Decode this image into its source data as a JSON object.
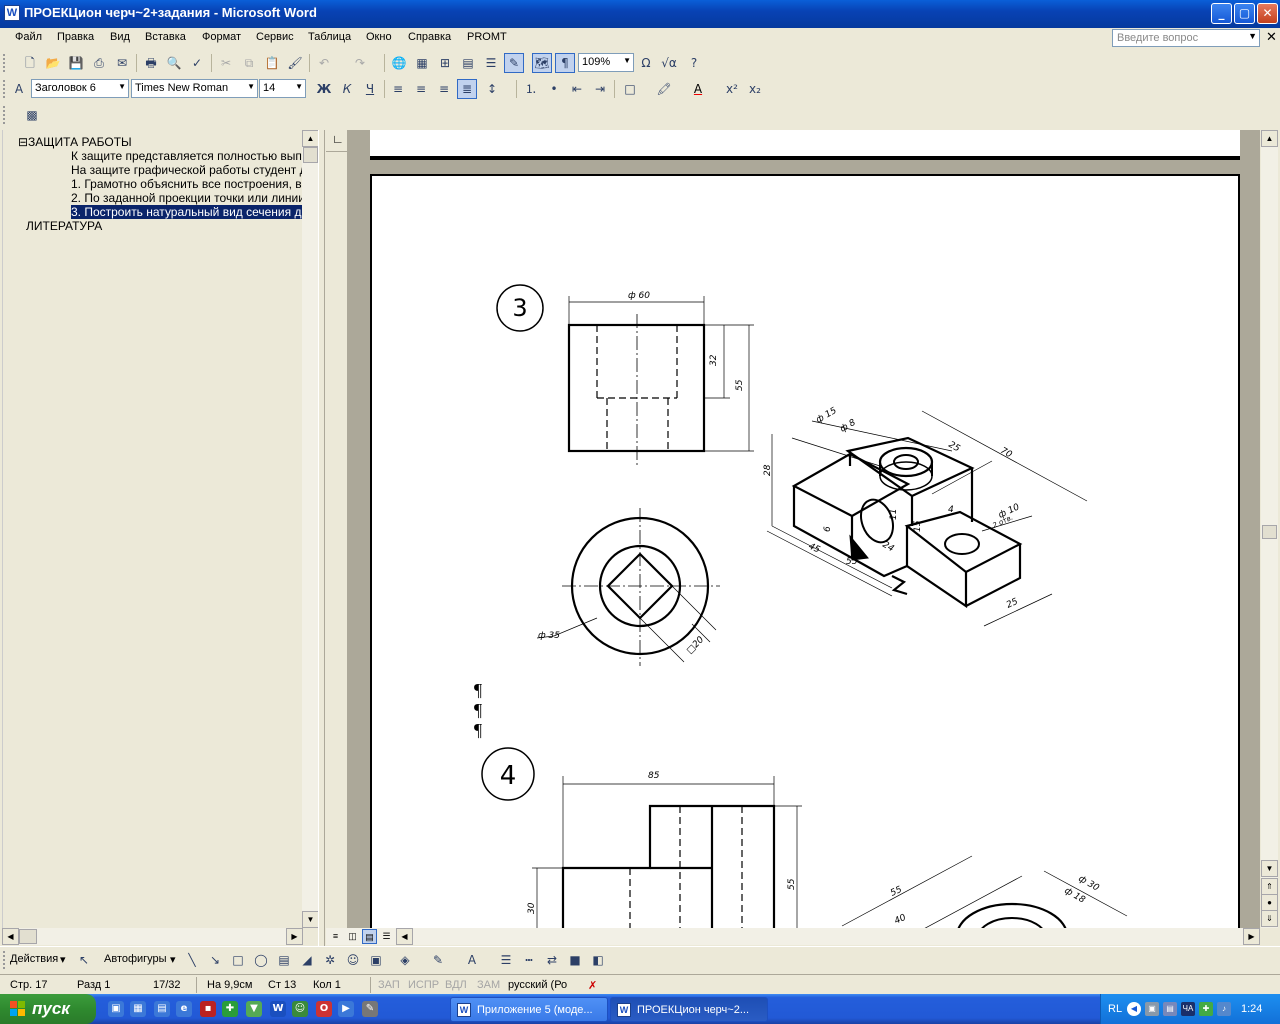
{
  "window": {
    "title": "ПРОЕКЦион черч~2+задания - Microsoft Word",
    "app_icon": "W",
    "buttons": {
      "minimize": "_",
      "maximize": "▢",
      "close": "✕"
    }
  },
  "menu": {
    "items": [
      "Файл",
      "Правка",
      "Вид",
      "Вставка",
      "Формат",
      "Сервис",
      "Таблица",
      "Окно",
      "Справка",
      "PROMT"
    ],
    "ask_placeholder": "Введите вопрос",
    "close_doc": "✕"
  },
  "standard_toolbar": {
    "zoom": "109%"
  },
  "format_toolbar": {
    "style": "Заголовок 6",
    "font": "Times New Roman",
    "size": "14"
  },
  "doc_map": {
    "lines": [
      "⊟ЗАЩИТА РАБОТЫ",
      "К защите представляется полностью вып",
      "На защите графической работы студент д",
      "1. Грамотно объяснить все построения, вы",
      "2. По заданной проекции точки или линии",
      "3. Построить натуральный вид сечения де",
      "ЛИТЕРАТУРА"
    ]
  },
  "ruler": {
    "tab_marker": "∟"
  },
  "document": {
    "pilcrows": [
      "¶",
      "¶",
      "¶"
    ],
    "drawing_3": {
      "number": "3",
      "dims": [
        "ф 60",
        "32",
        "55",
        "ф 35",
        "□20",
        "ф 15",
        "ф 8",
        "25",
        "70",
        "28",
        "11",
        "15",
        "4",
        "ф 10",
        "2 отв.",
        "45",
        "55",
        "24",
        "6",
        "25"
      ]
    },
    "drawing_4": {
      "number": "4",
      "dims": [
        "85",
        "55",
        "30",
        "55",
        "40",
        "ф 30",
        "ф 18"
      ]
    }
  },
  "draw_toolbar": {
    "actions": "Действия",
    "autoshapes": "Автофигуры"
  },
  "status": {
    "page": "Стр. 17",
    "section": "Разд 1",
    "pages": "17/32",
    "at": "На 9,9см",
    "line": "Ст 13",
    "col": "Кол 1",
    "rec": "ЗАП",
    "trk": "ИСПР",
    "ext": "ВДЛ",
    "ovr": "ЗАМ",
    "lang": "русский (Ро"
  },
  "taskbar": {
    "start": "пуск",
    "items": [
      "Приложение 5 (моде...",
      "ПРОЕКЦион черч~2..."
    ],
    "tray": {
      "lang": "RL",
      "kb": "ЧА",
      "time": "1:24"
    }
  },
  "colors": {
    "titlebar": "#0842b4",
    "selection": "#0a246a",
    "start": "#2f8a2f",
    "workspace": "#aca899"
  }
}
